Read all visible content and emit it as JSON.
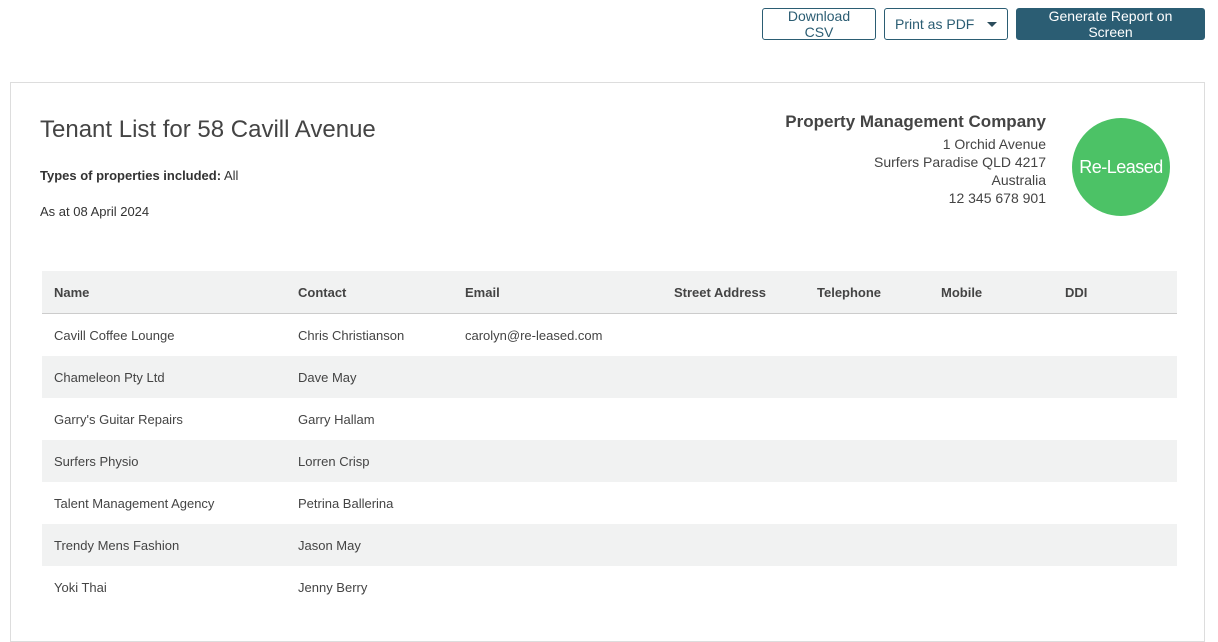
{
  "toolbar": {
    "download_csv_label": "Download CSV",
    "print_pdf_label": "Print as PDF",
    "generate_label": "Generate Report on Screen"
  },
  "report": {
    "title": "Tenant List for 58 Cavill Avenue",
    "types_label": "Types of properties included:",
    "types_value": "All",
    "as_at": "As at 08 April 2024"
  },
  "company": {
    "name": "Property Management Company",
    "address1": "1 Orchid Avenue",
    "address2": "Surfers Paradise QLD 4217",
    "country": "Australia",
    "phone": "12 345 678 901",
    "logo_text": "Re-Leased",
    "logo_color": "#4cc266"
  },
  "table": {
    "headers": [
      "Name",
      "Contact",
      "Email",
      "Street Address",
      "Telephone",
      "Mobile",
      "DDI"
    ],
    "rows": [
      [
        "Cavill Coffee Lounge",
        "Chris Christianson",
        "carolyn@re-leased.com",
        "",
        "",
        "",
        ""
      ],
      [
        "Chameleon Pty Ltd",
        "Dave May",
        "",
        "",
        "",
        "",
        ""
      ],
      [
        "Garry's Guitar Repairs",
        "Garry Hallam",
        "",
        "",
        "",
        "",
        ""
      ],
      [
        "Surfers Physio",
        "Lorren Crisp",
        "",
        "",
        "",
        "",
        ""
      ],
      [
        "Talent Management Agency",
        "Petrina Ballerina",
        "",
        "",
        "",
        "",
        ""
      ],
      [
        "Trendy Mens Fashion",
        "Jason May",
        "",
        "",
        "",
        "",
        ""
      ],
      [
        "Yoki Thai",
        "Jenny Berry",
        "",
        "",
        "",
        "",
        ""
      ]
    ]
  },
  "colors": {
    "primary": "#2b5d73",
    "stripe": "#f1f2f2"
  }
}
